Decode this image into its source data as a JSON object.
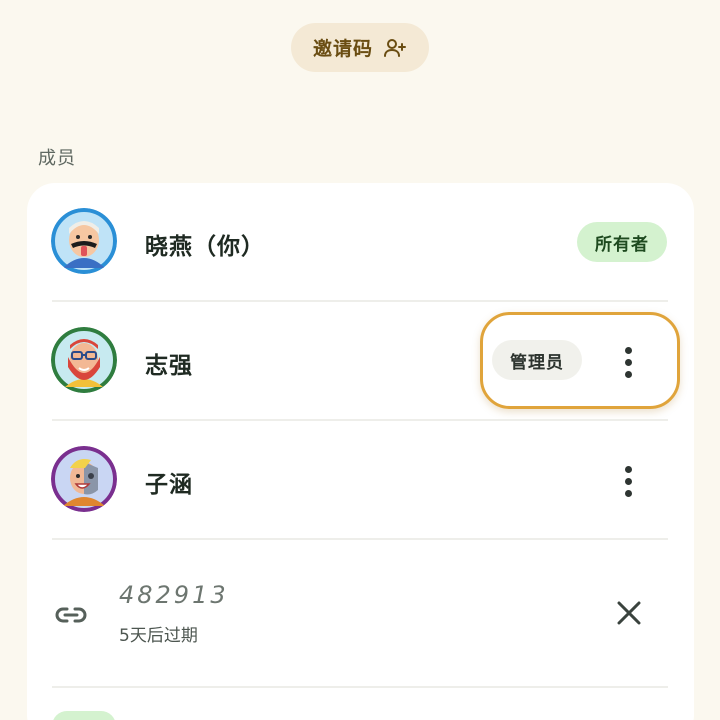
{
  "header": {
    "invite_label": "邀请码"
  },
  "members_section": {
    "title": "成员"
  },
  "members": [
    {
      "name": "晓燕（你）",
      "role_badge": "所有者",
      "avatar_border": "#2a8fd6"
    },
    {
      "name": "志强",
      "role_badge": "管理员",
      "avatar_border": "#2f7d3f"
    },
    {
      "name": "子涵",
      "role_badge": "",
      "avatar_border": "#7a2f8f"
    }
  ],
  "invite_code": {
    "code": "482913",
    "expiry": "5天后过期"
  },
  "colors": {
    "background": "#fbf8ef",
    "card": "#ffffff",
    "invite_button_bg": "#f4e9d5",
    "owner_badge_bg": "#d4f2cf",
    "admin_badge_bg": "#f1f1ec",
    "focus_ring": "#e0a43b"
  },
  "icons": {
    "invite": "person-add-icon",
    "more": "more-vertical-icon",
    "link": "link-icon",
    "close": "close-icon"
  }
}
